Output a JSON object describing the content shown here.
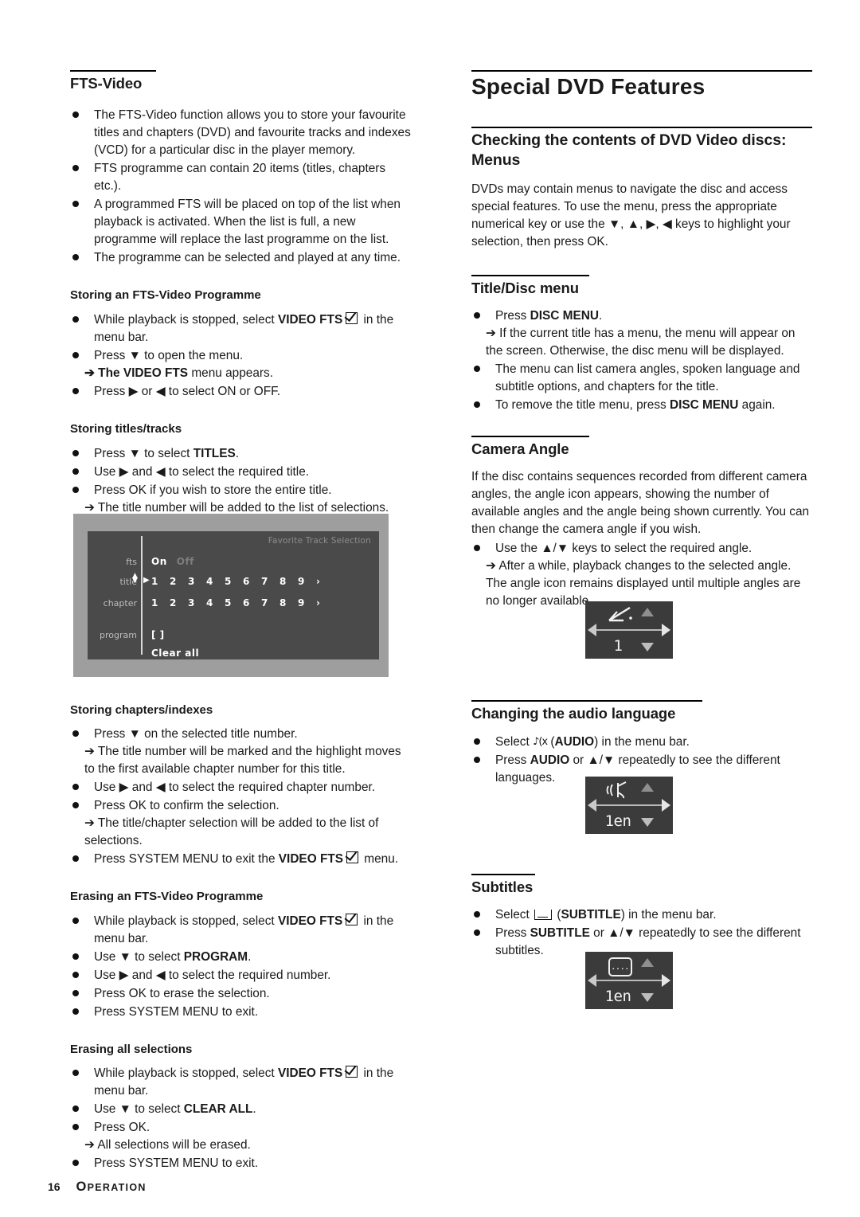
{
  "left_column": {
    "heading": "FTS-Video",
    "intro_bullets": [
      "The FTS-Video function allows you to store your favourite titles and chapters (DVD) and favourite tracks and indexes (VCD) for a particular disc in the player memory.",
      "FTS programme can contain 20 items (titles, chapters etc.).",
      "A programmed FTS will be placed on top of the list when playback is activated. When the list is full, a new programme will replace the last programme on the list.",
      "The programme can be selected and played at any time."
    ],
    "storing_programme": {
      "heading": "Storing an FTS-Video Programme",
      "b1_pre": "While playback is stopped, select ",
      "b1_bold": "VIDEO FTS",
      "b1_post": " in the menu bar.",
      "b2": "Press ▼ to open the menu.",
      "b2_arrow_pre": "➔ The ",
      "b2_arrow_bold": "VIDEO FTS",
      "b2_arrow_post": " menu appears.",
      "b3": "Press ▶ or ◀  to select ON or OFF."
    },
    "storing_titles": {
      "heading": "Storing titles/tracks",
      "b1_pre": "Press ▼ to select ",
      "b1_bold": "TITLES",
      "b1_post": ".",
      "b2": "Use ▶ and ◀ to select the required title.",
      "b3": "Press OK if you wish to store the entire title.",
      "b3_arrow": "➔ The title number will be added to the list of selections."
    },
    "fts_screenshot": {
      "title": "Favorite Track Selection",
      "labels": {
        "fts": "fts",
        "title": "title",
        "chapter": "chapter",
        "program": "program"
      },
      "fts_on": "On",
      "fts_off": "Off",
      "title_numbers": [
        "1",
        "2",
        "3",
        "4",
        "5",
        "6",
        "7",
        "8",
        "9"
      ],
      "chapter_numbers": [
        "1",
        "2",
        "3",
        "4",
        "5",
        "6",
        "7",
        "8",
        "9"
      ],
      "more_caret": "›",
      "program_value": "[ ]",
      "clear_all": "Clear all"
    },
    "storing_chapters": {
      "heading": "Storing chapters/indexes",
      "b1": "Press ▼ on the selected title number.",
      "b1_arrow": "➔ The title number will be marked and the highlight moves to the first available chapter number for this title.",
      "b2": "Use ▶ and ◀ to select the required chapter number.",
      "b3": "Press OK to confirm the selection.",
      "b3_arrow": "➔ The title/chapter selection will be added to the list of selections.",
      "b4_pre": "Press SYSTEM MENU to exit the ",
      "b4_bold": "VIDEO FTS",
      "b4_post": " menu."
    },
    "erasing_programme": {
      "heading": "Erasing an FTS-Video Programme",
      "b1_pre": "While playback is stopped, select ",
      "b1_bold": "VIDEO FTS",
      "b1_post": " in the menu bar.",
      "b2_pre": "Use ▼ to select ",
      "b2_bold": "PROGRAM",
      "b2_post": ".",
      "b3": "Use ▶ and ◀ to select the required number.",
      "b4": "Press OK to erase the selection.",
      "b5": "Press SYSTEM MENU to exit."
    },
    "erasing_all": {
      "heading": "Erasing all selections",
      "b1_pre": "While playback is stopped, select ",
      "b1_bold": "VIDEO FTS",
      "b1_post": " in the menu bar.",
      "b2_pre": "Use ▼ to select ",
      "b2_bold": "CLEAR ALL",
      "b2_post": ".",
      "b3": "Press OK.",
      "b3_arrow": "➔ All selections will be erased.",
      "b4": "Press SYSTEM MENU to exit."
    }
  },
  "right_column": {
    "title": "Special DVD Features",
    "menus": {
      "heading": "Checking the contents of DVD Video discs: Menus",
      "paragraph": "DVDs may contain menus to navigate the disc and access special features. To use the menu, press the appropriate numerical key or use the ▼, ▲, ▶, ◀ keys to highlight your selection, then press OK."
    },
    "title_disc_menu": {
      "heading": "Title/Disc menu",
      "b1_pre": "Press ",
      "b1_bold": "DISC MENU",
      "b1_post": ".",
      "b1_arrow": "➔ If the current title has a menu, the menu will appear on the screen. Otherwise, the disc menu will be displayed.",
      "b2": "The menu can list camera angles, spoken language and subtitle options, and chapters for the title.",
      "b3_pre": "To remove the title menu, press ",
      "b3_bold": "DISC MENU",
      "b3_post": " again."
    },
    "camera_angle": {
      "heading": "Camera Angle",
      "paragraph": "If the disc contains sequences recorded from different camera angles, the angle icon appears, showing the number of available angles and the angle being shown currently. You can then change the camera angle if you wish.",
      "b1": "Use the ▲/▼ keys to select the required angle.",
      "b1_arrow": "➔ After a while, playback changes to the selected angle. The angle  icon remains displayed until multiple angles are no longer available.",
      "osd_value": "1"
    },
    "audio_language": {
      "heading": "Changing the audio language",
      "b1_pre": "Select ",
      "b1_icon": "audio-icon",
      "b1_mid": " (",
      "b1_bold": "AUDIO",
      "b1_post": ") in the menu bar.",
      "b2_pre": "Press ",
      "b2_bold": "AUDIO",
      "b2_post": " or ▲/▼ repeatedly to see the different languages.",
      "osd_value": "1en"
    },
    "subtitles": {
      "heading": "Subtitles",
      "b1_pre": "Select ",
      "b1_icon": "subtitle-icon",
      "b1_mid": " (",
      "b1_bold": "SUBTITLE",
      "b1_post": ") in the menu bar.",
      "b2_pre": "Press ",
      "b2_bold": "SUBTITLE",
      "b2_post": " or ▲/▼ repeatedly to see the different subtitles.",
      "osd_value": "1en"
    }
  },
  "footer": {
    "page_number": "16",
    "section_cap": "O",
    "section_rest": "PERATION"
  },
  "colors": {
    "text": "#1a1a1a",
    "osd_bg": "#3b3b3b",
    "fts_bg": "#4a4a4a",
    "fts_frame": "#9e9e9e"
  }
}
